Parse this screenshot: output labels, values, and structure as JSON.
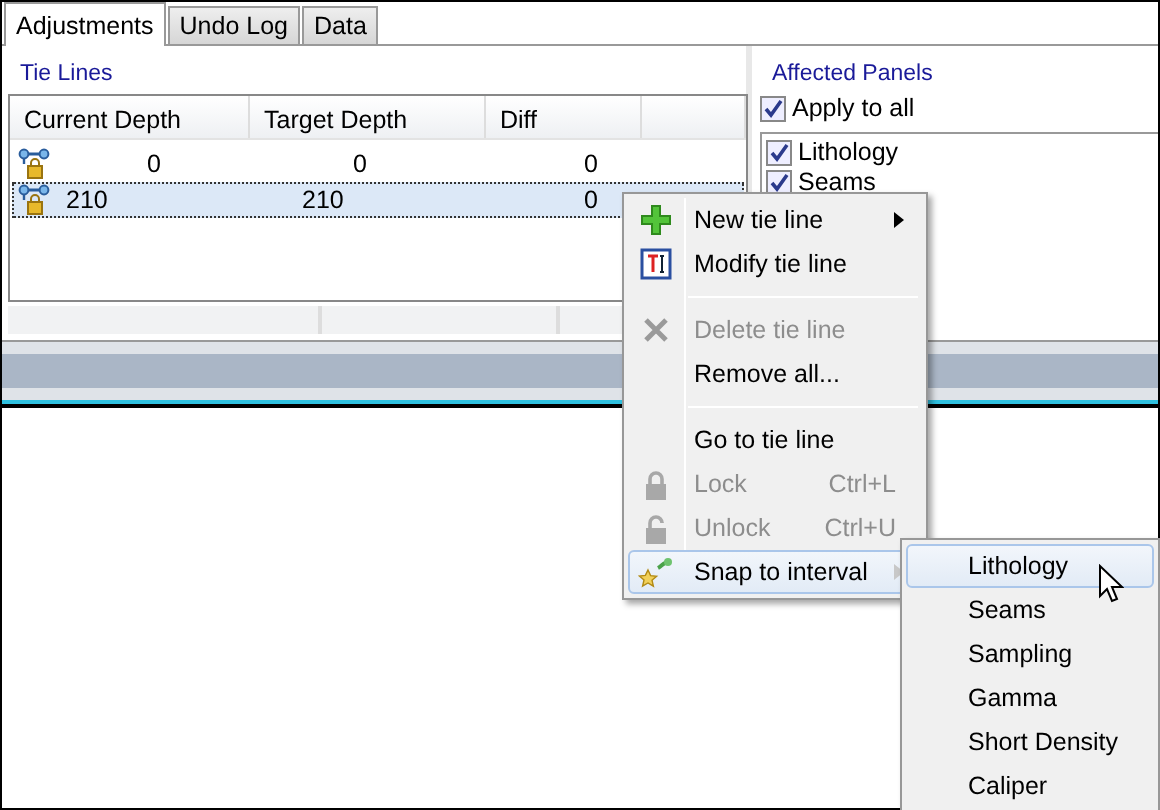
{
  "tabs": [
    {
      "label": "Adjustments",
      "selected": true
    },
    {
      "label": "Undo Log",
      "selected": false
    },
    {
      "label": "Data",
      "selected": false
    }
  ],
  "tie_lines": {
    "title": "Tie Lines",
    "columns": [
      "Current Depth",
      "Target Depth",
      "Diff"
    ],
    "rows": [
      {
        "cells": [
          "0",
          "0",
          "0"
        ],
        "selected": false
      },
      {
        "cells": [
          "210",
          "210",
          "0"
        ],
        "selected": true
      }
    ]
  },
  "affected_panels": {
    "title": "Affected Panels",
    "apply_to_all": {
      "label": "Apply to all",
      "checked": true
    },
    "panels": [
      {
        "label": "Lithology",
        "checked": true
      },
      {
        "label": "Seams",
        "checked": true
      }
    ]
  },
  "context_menu": {
    "items": [
      {
        "kind": "item",
        "label": "New tie line",
        "disabled": false,
        "submenu": true,
        "highlighted": false
      },
      {
        "kind": "item",
        "label": "Modify tie line",
        "disabled": false,
        "submenu": false,
        "highlighted": false
      },
      {
        "kind": "separator"
      },
      {
        "kind": "item",
        "label": "Delete tie line",
        "disabled": true,
        "submenu": false,
        "highlighted": false
      },
      {
        "kind": "item",
        "label": "Remove all...",
        "disabled": false,
        "submenu": false,
        "highlighted": false
      },
      {
        "kind": "separator"
      },
      {
        "kind": "item",
        "label": "Go to tie line",
        "disabled": false,
        "submenu": false,
        "highlighted": false
      },
      {
        "kind": "item",
        "label": "Lock",
        "shortcut": "Ctrl+L",
        "disabled": true,
        "submenu": false,
        "highlighted": false
      },
      {
        "kind": "item",
        "label": "Unlock",
        "shortcut": "Ctrl+U",
        "disabled": true,
        "submenu": false,
        "highlighted": false
      },
      {
        "kind": "item",
        "label": "Snap to interval",
        "disabled": false,
        "submenu": true,
        "highlighted": true
      }
    ]
  },
  "submenu": {
    "items": [
      {
        "label": "Lithology",
        "highlighted": true
      },
      {
        "label": "Seams",
        "highlighted": false
      },
      {
        "label": "Sampling",
        "highlighted": false
      },
      {
        "label": "Gamma",
        "highlighted": false
      },
      {
        "label": "Short Density",
        "highlighted": false
      },
      {
        "label": "Caliper",
        "highlighted": false
      }
    ]
  }
}
